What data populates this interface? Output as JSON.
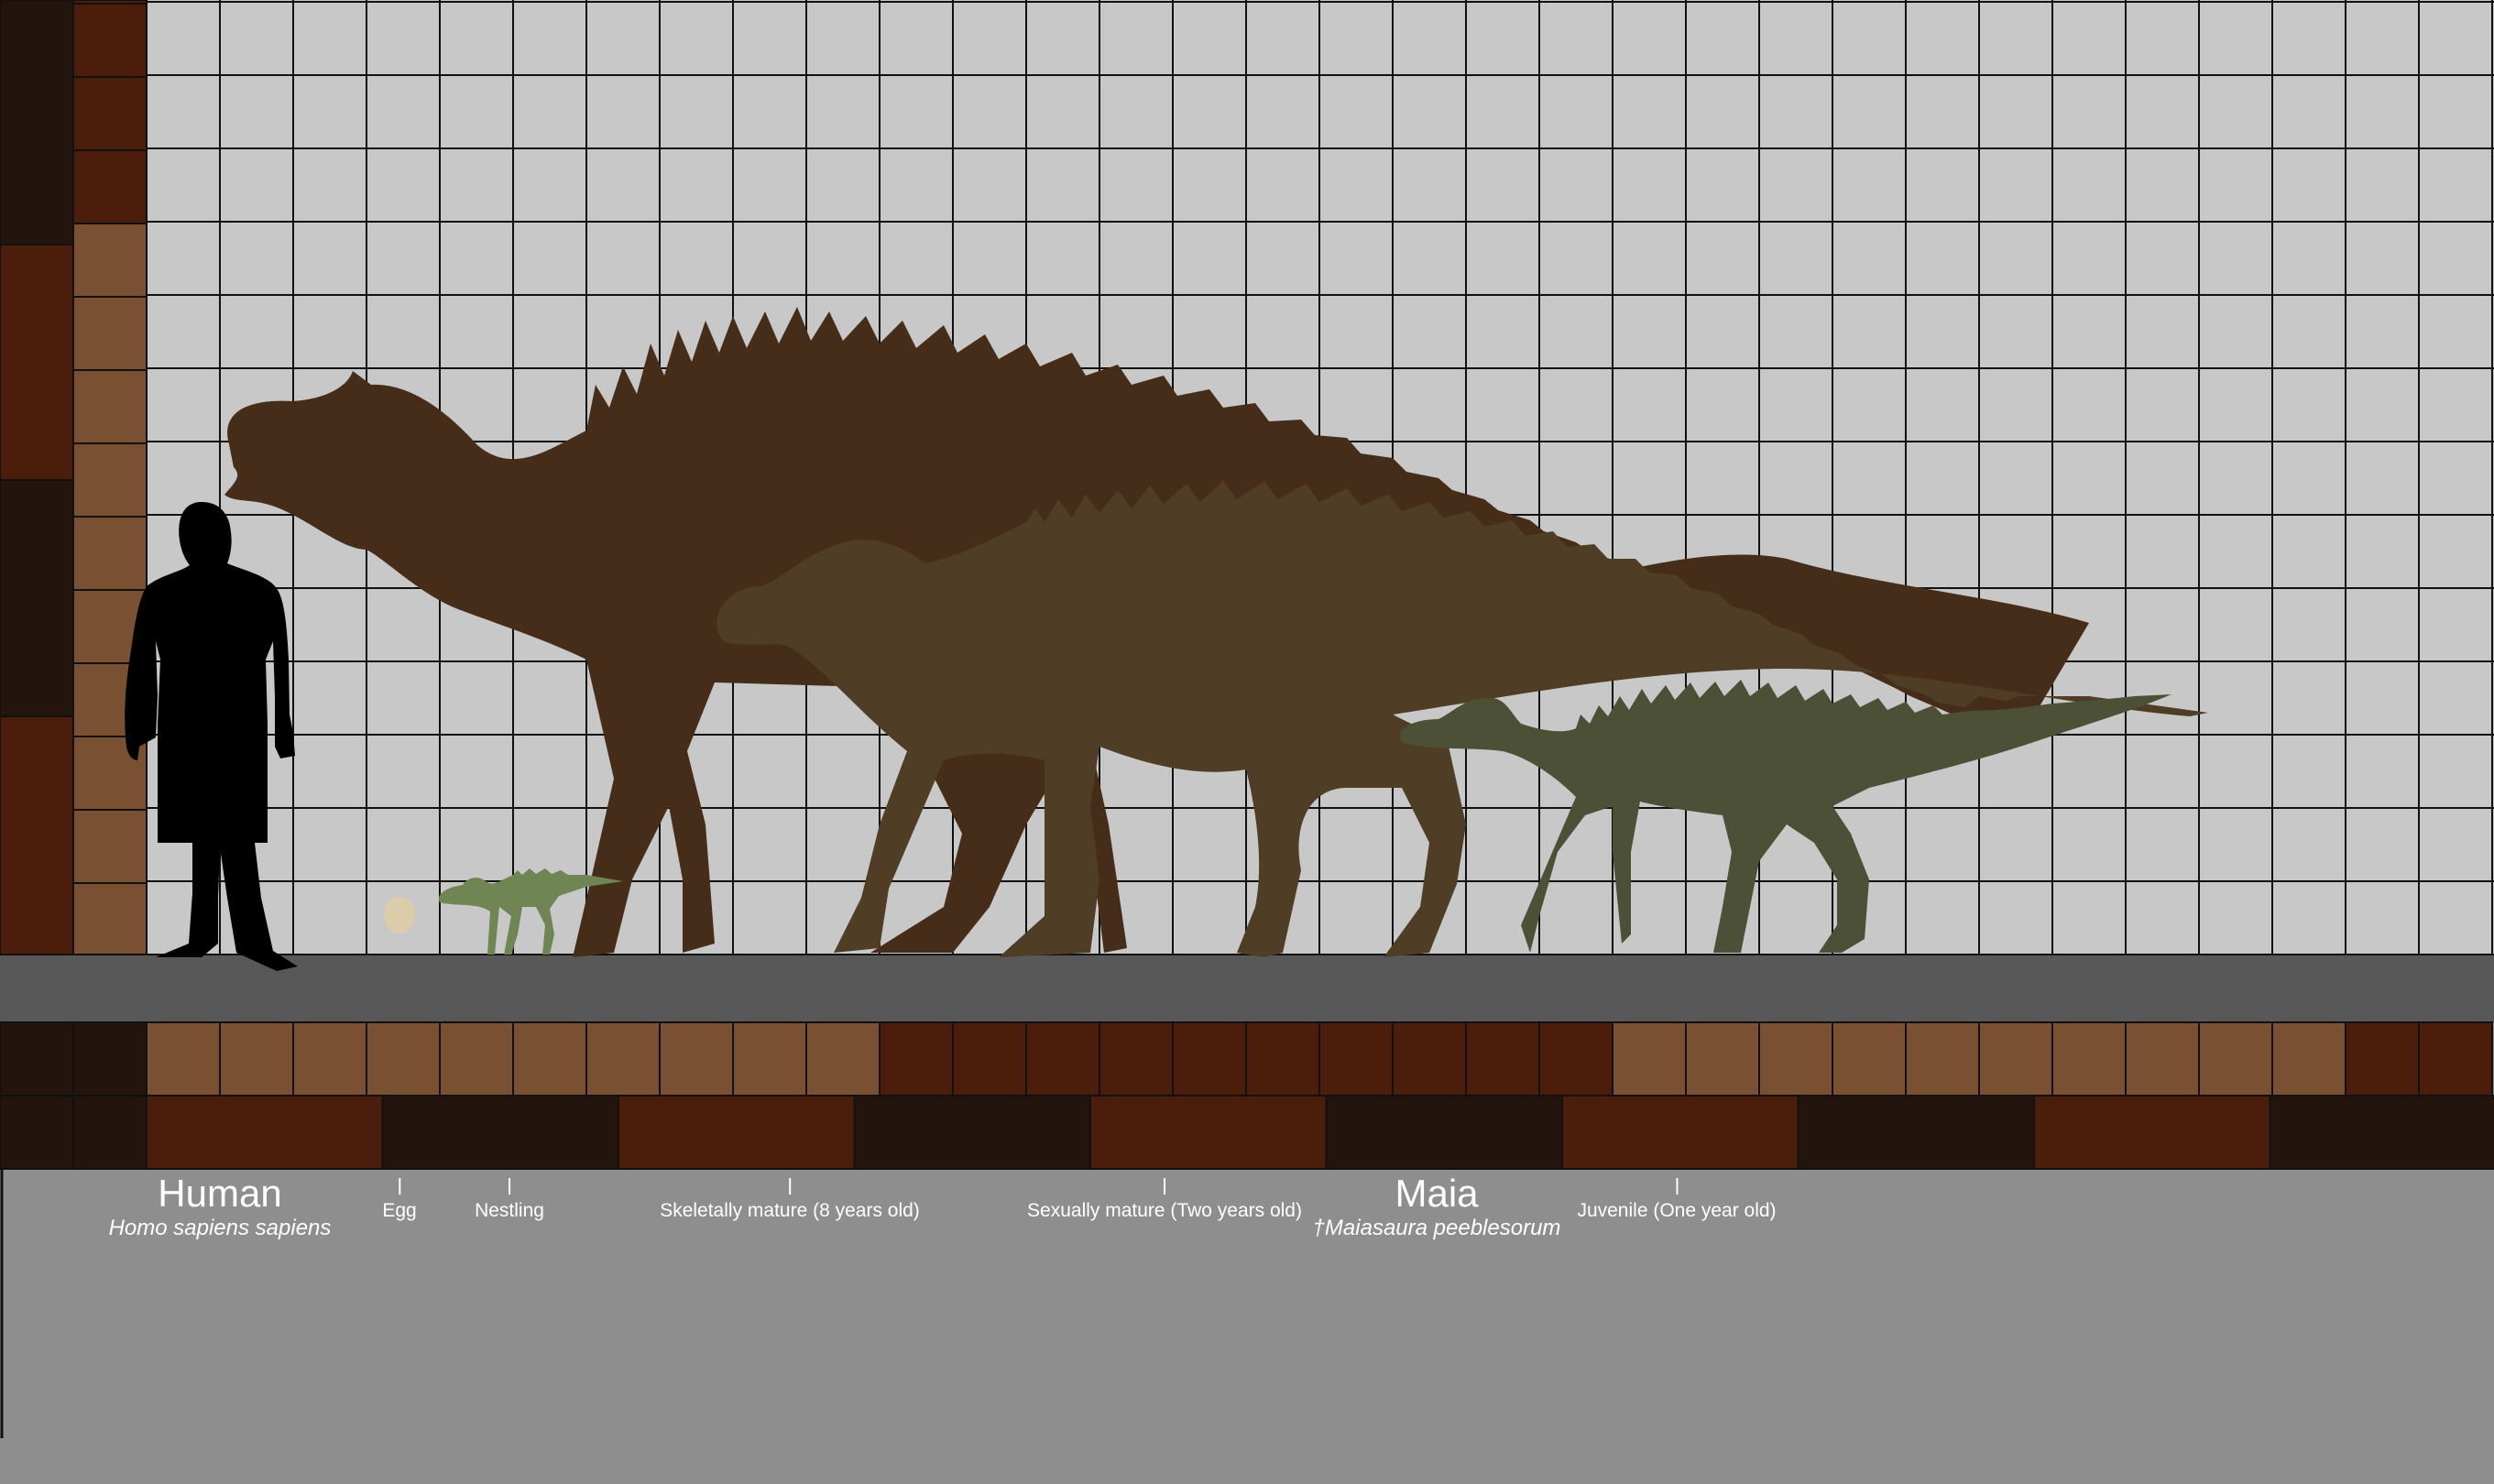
{
  "colors": {
    "background": "#8e8e8e",
    "wall": "#c8c8c8",
    "grid_line": "#111111",
    "ground": "#585858",
    "scale_dark": "#23140d",
    "scale_rust": "#4b1d0b",
    "scale_light": "#7a5032",
    "adult_large": "#462d19",
    "adult_mature": "#4f3d26",
    "juvenile": "#4c5036",
    "nestling": "#6f8553",
    "egg": "#ddccaa",
    "human": "#000000",
    "text": "#ffffff"
  },
  "labels": {
    "human_name": "Human",
    "human_species": "Homo sapiens sapiens",
    "egg": "Egg",
    "nestling": "Nestling",
    "skeletal": "Skeletally mature (8 years old)",
    "sexual": "Sexually mature (Two years old)",
    "maia_name": "Maia",
    "maia_species": "†Maiasaura peeblesorum",
    "juvenile": "Juvenile (One year old)"
  },
  "silhouettes": [
    {
      "name": "human-silhouette",
      "label_key": "human_name"
    },
    {
      "name": "egg-shape",
      "label_key": "egg"
    },
    {
      "name": "nestling-silhouette",
      "label_key": "nestling"
    },
    {
      "name": "skeletally-mature-silhouette",
      "label_key": "skeletal"
    },
    {
      "name": "sexually-mature-silhouette",
      "label_key": "sexual"
    },
    {
      "name": "juvenile-silhouette",
      "label_key": "juvenile"
    }
  ]
}
